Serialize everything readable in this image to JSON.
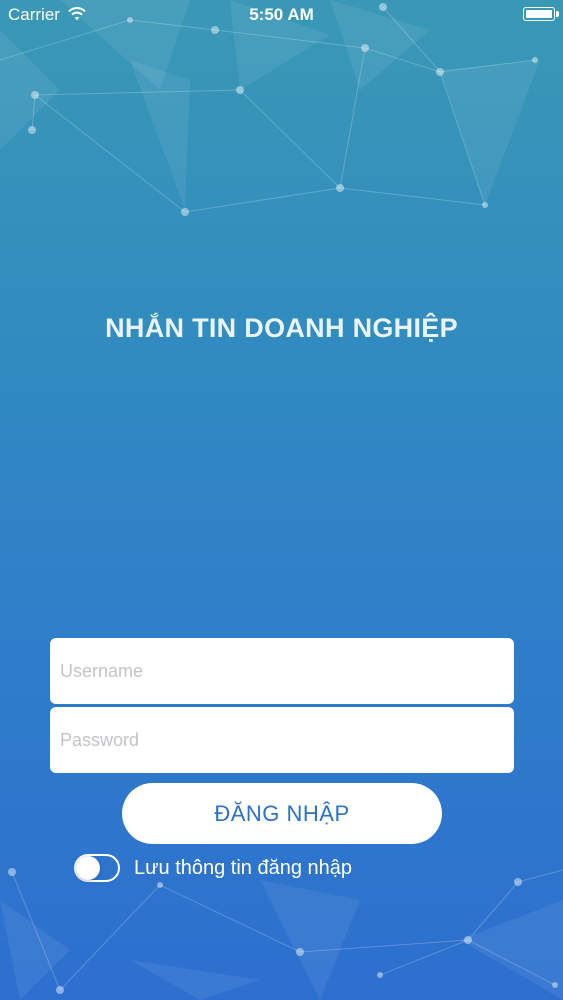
{
  "status_bar": {
    "carrier": "Carrier",
    "time": "5:50 AM",
    "wifi_icon": "wifi-icon",
    "battery_icon": "battery-icon",
    "battery_level": 1.0
  },
  "title": "NHẮN TIN DOANH NGHIỆP",
  "form": {
    "username": {
      "placeholder": "Username",
      "value": ""
    },
    "password": {
      "placeholder": "Password",
      "value": ""
    },
    "login_label": "ĐĂNG NHẬP",
    "remember_label": "Lưu thông tin đăng nhập",
    "remember_on": false
  },
  "colors": {
    "background_top": "#3a98b6",
    "background_bottom": "#2d6fcf",
    "button_text": "#2f6fc8"
  }
}
